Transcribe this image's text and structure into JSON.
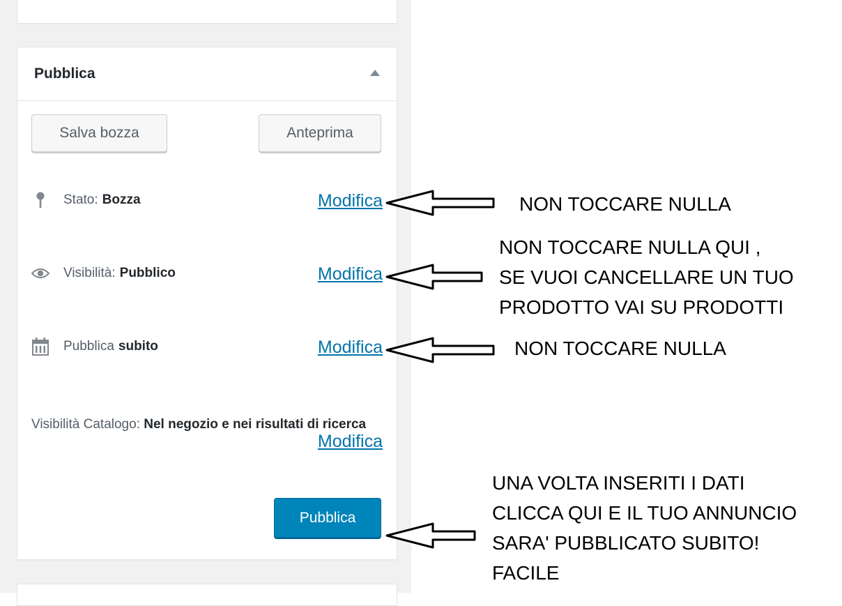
{
  "publish_box": {
    "title": "Pubblica",
    "save_draft_label": "Salva bozza",
    "preview_label": "Anteprima",
    "status": {
      "label": "Stato:",
      "value": "Bozza",
      "edit_label": "Modifica",
      "icon": "pin-icon"
    },
    "visibility": {
      "label": "Visibilità:",
      "value": "Pubblico",
      "edit_label": "Modifica",
      "icon": "eye-icon"
    },
    "schedule": {
      "label": "Pubblica",
      "value": "subito",
      "edit_label": "Modifica",
      "icon": "calendar-icon"
    },
    "catalog_visibility": {
      "label": "Visibilità Catalogo:",
      "value": "Nel negozio e nei risultati di ricerca",
      "edit_label": "Modifica"
    },
    "publish_label": "Pubblica"
  },
  "annotations": {
    "note_status": "NON TOCCARE NULLA",
    "note_visibility_lines": [
      "NON TOCCARE NULLA QUI ,",
      "SE VUOI CANCELLARE UN TUO",
      "PRODOTTO VAI SU PRODOTTI"
    ],
    "note_schedule": "NON TOCCARE NULLA",
    "note_publish_lines": [
      "UNA VOLTA INSERITI I DATI",
      "CLICCA QUI E IL TUO ANNUNCIO",
      "SARA' PUBBLICATO SUBITO!",
      "FACILE"
    ]
  },
  "colors": {
    "link": "#0073aa",
    "primary_button": "#0085ba",
    "sidebar_background": "#f1f1f1"
  }
}
